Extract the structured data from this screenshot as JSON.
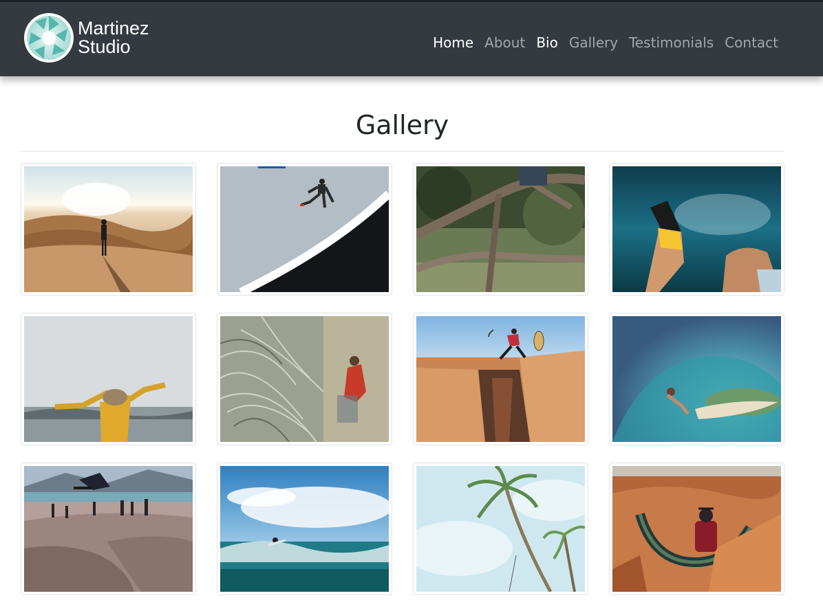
{
  "brand": {
    "line1": "Martinez",
    "line2": "Studio",
    "logo_icon": "aperture-icon",
    "logo_color": "#56b7ae"
  },
  "nav": {
    "items": [
      {
        "label": "Home",
        "active": true
      },
      {
        "label": "About",
        "active": false
      },
      {
        "label": "Bio",
        "active": true
      },
      {
        "label": "Gallery",
        "active": false
      },
      {
        "label": "Testimonials",
        "active": false
      },
      {
        "label": "Contact",
        "active": false
      }
    ]
  },
  "page": {
    "title": "Gallery"
  },
  "gallery": {
    "images": [
      {
        "subject": "desert-dunes-walker"
      },
      {
        "subject": "skatepark-jumper"
      },
      {
        "subject": "tree-branches"
      },
      {
        "subject": "underwater-diver-fins"
      },
      {
        "subject": "foggy-coast-arms-open"
      },
      {
        "subject": "dune-grass-hiker"
      },
      {
        "subject": "canyon-leap"
      },
      {
        "subject": "surfer-in-barrel"
      },
      {
        "subject": "beach-skatepark"
      },
      {
        "subject": "ocean-surfer"
      },
      {
        "subject": "palm-trees-sky"
      },
      {
        "subject": "horseshoe-bend-sitter"
      }
    ]
  },
  "colors": {
    "navbar": "#343a40",
    "nav_active": "#ffffff",
    "nav_inactive": "#9a9da0",
    "thumb_border": "#dee2e6"
  }
}
